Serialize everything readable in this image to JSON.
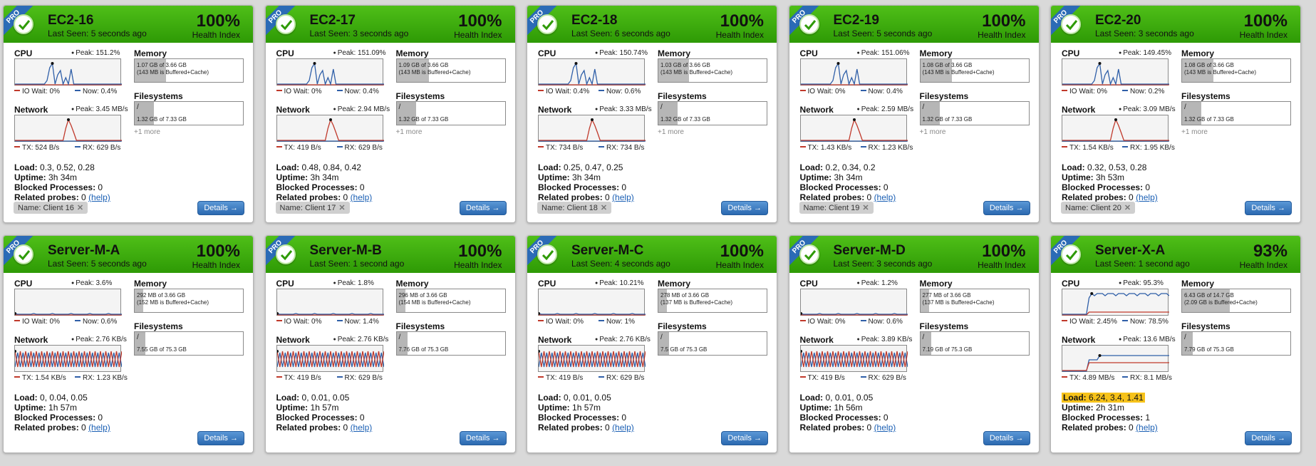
{
  "header": {
    "pro_label": "PRO",
    "health_label": "Health Index"
  },
  "labels": {
    "cpu": "CPU",
    "network": "Network",
    "memory": "Memory",
    "filesystems": "Filesystems",
    "io_wait": "IO Wait:",
    "now": "Now:",
    "peak": "Peak:",
    "tx": "TX:",
    "rx": "RX:",
    "load": "Load:",
    "uptime": "Uptime:",
    "blocked": "Blocked Processes:",
    "related": "Related probes:",
    "help": "(help)",
    "details": "Details →",
    "more": "+1 more"
  },
  "colors": {
    "header_green": "#3aae0e",
    "cpu_line": "#2f5fa8",
    "io_line": "#c0392b",
    "warn": "#f6c21a",
    "button_blue": "#2b69b0"
  },
  "servers": [
    {
      "name": "EC2-16",
      "last_seen": "Last Seen: 5 seconds ago",
      "health": "100%",
      "cpu_peak": "151.2%",
      "io_wait": "0%",
      "now": "0.4%",
      "net_peak": "3.45 MB/s",
      "tx": "524 B/s",
      "rx": "629 B/s",
      "mem_text": "1.07 GB of 3.66 GB",
      "mem_sub": "(143 MB is Buffered+Cache)",
      "mem_frac": 0.29,
      "fs_mount": "/",
      "fs_text": "1.32 GB of 7.33 GB",
      "fs_frac": 0.18,
      "more": "+1 more",
      "load": "0.3, 0.52, 0.28",
      "load_warn": false,
      "uptime": "3h 34m",
      "blocked": "0",
      "related": "0",
      "tag": "Name: Client 16",
      "cpu_profile": "burst",
      "net_profile": "burst"
    },
    {
      "name": "EC2-17",
      "last_seen": "Last Seen: 3 seconds ago",
      "health": "100%",
      "cpu_peak": "151.09%",
      "io_wait": "0%",
      "now": "0.4%",
      "net_peak": "2.94 MB/s",
      "tx": "419 B/s",
      "rx": "629 B/s",
      "mem_text": "1.09 GB of 3.66 GB",
      "mem_sub": "(143 MB is Buffered+Cache)",
      "mem_frac": 0.3,
      "fs_mount": "/",
      "fs_text": "1.32 GB of 7.33 GB",
      "fs_frac": 0.18,
      "more": "+1 more",
      "load": "0.48, 0.84, 0.42",
      "load_warn": false,
      "uptime": "3h 34m",
      "blocked": "0",
      "related": "0",
      "tag": "Name: Client 17",
      "cpu_profile": "burst",
      "net_profile": "burst"
    },
    {
      "name": "EC2-18",
      "last_seen": "Last Seen: 6 seconds ago",
      "health": "100%",
      "cpu_peak": "150.74%",
      "io_wait": "0.4%",
      "now": "0.6%",
      "net_peak": "3.33 MB/s",
      "tx": "734 B/s",
      "rx": "734 B/s",
      "mem_text": "1.03 GB of 3.66 GB",
      "mem_sub": "(143 MB is Buffered+Cache)",
      "mem_frac": 0.28,
      "fs_mount": "/",
      "fs_text": "1.32 GB of 7.33 GB",
      "fs_frac": 0.18,
      "more": "+1 more",
      "load": "0.25, 0.47, 0.25",
      "load_warn": false,
      "uptime": "3h 34m",
      "blocked": "0",
      "related": "0",
      "tag": "Name: Client 18",
      "cpu_profile": "burst",
      "net_profile": "burst"
    },
    {
      "name": "EC2-19",
      "last_seen": "Last Seen: 5 seconds ago",
      "health": "100%",
      "cpu_peak": "151.06%",
      "io_wait": "0%",
      "now": "0.4%",
      "net_peak": "2.59 MB/s",
      "tx": "1.43 KB/s",
      "rx": "1.23 KB/s",
      "mem_text": "1.08 GB of 3.66 GB",
      "mem_sub": "(143 MB is Buffered+Cache)",
      "mem_frac": 0.29,
      "fs_mount": "/",
      "fs_text": "1.32 GB of 7.33 GB",
      "fs_frac": 0.18,
      "more": "+1 more",
      "load": "0.2, 0.34, 0.2",
      "load_warn": false,
      "uptime": "3h 34m",
      "blocked": "0",
      "related": "0",
      "tag": "Name: Client 19",
      "cpu_profile": "burst",
      "net_profile": "burst"
    },
    {
      "name": "EC2-20",
      "last_seen": "Last Seen: 3 seconds ago",
      "health": "100%",
      "cpu_peak": "149.45%",
      "io_wait": "0%",
      "now": "0.2%",
      "net_peak": "3.09 MB/s",
      "tx": "1.54 KB/s",
      "rx": "1.95 KB/s",
      "mem_text": "1.08 GB of 3.66 GB",
      "mem_sub": "(143 MB is Buffered+Cache)",
      "mem_frac": 0.29,
      "fs_mount": "/",
      "fs_text": "1.32 GB of 7.33 GB",
      "fs_frac": 0.18,
      "more": "+1 more",
      "load": "0.32, 0.53, 0.28",
      "load_warn": false,
      "uptime": "3h 53m",
      "blocked": "0",
      "related": "0",
      "tag": "Name: Client 20",
      "cpu_profile": "burst",
      "net_profile": "burst"
    },
    {
      "name": "Server-M-A",
      "last_seen": "Last Seen: 5 seconds ago",
      "health": "100%",
      "cpu_peak": "3.6%",
      "io_wait": "0%",
      "now": "0.6%",
      "net_peak": "2.76 KB/s",
      "tx": "1.54 KB/s",
      "rx": "1.23 KB/s",
      "mem_text": "292 MB of 3.66 GB",
      "mem_sub": "(152 MB is Buffered+Cache)",
      "mem_frac": 0.08,
      "fs_mount": "/",
      "fs_text": "7.55 GB of 75.3 GB",
      "fs_frac": 0.1,
      "more": "",
      "load": "0, 0.04, 0.05",
      "load_warn": false,
      "uptime": "1h 57m",
      "blocked": "0",
      "related": "0",
      "tag": "",
      "cpu_profile": "flat",
      "net_profile": "zigzag"
    },
    {
      "name": "Server-M-B",
      "last_seen": "Last Seen: 1 second ago",
      "health": "100%",
      "cpu_peak": "1.8%",
      "io_wait": "0%",
      "now": "1.4%",
      "net_peak": "2.76 KB/s",
      "tx": "419 B/s",
      "rx": "629 B/s",
      "mem_text": "296 MB of 3.66 GB",
      "mem_sub": "(154 MB is Buffered+Cache)",
      "mem_frac": 0.08,
      "fs_mount": "/",
      "fs_text": "7.76 GB of 75.3 GB",
      "fs_frac": 0.1,
      "more": "",
      "load": "0, 0.01, 0.05",
      "load_warn": false,
      "uptime": "1h 57m",
      "blocked": "0",
      "related": "0",
      "tag": "",
      "cpu_profile": "flat",
      "net_profile": "zigzag"
    },
    {
      "name": "Server-M-C",
      "last_seen": "Last Seen: 4 seconds ago",
      "health": "100%",
      "cpu_peak": "10.21%",
      "io_wait": "0%",
      "now": "1%",
      "net_peak": "2.76 KB/s",
      "tx": "419 B/s",
      "rx": "629 B/s",
      "mem_text": "278 MB of 3.66 GB",
      "mem_sub": "(137 MB is Buffered+Cache)",
      "mem_frac": 0.08,
      "fs_mount": "/",
      "fs_text": "7.5 GB of 75.3 GB",
      "fs_frac": 0.1,
      "more": "",
      "load": "0, 0.01, 0.05",
      "load_warn": false,
      "uptime": "1h 57m",
      "blocked": "0",
      "related": "0",
      "tag": "",
      "cpu_profile": "flat",
      "net_profile": "zigzag"
    },
    {
      "name": "Server-M-D",
      "last_seen": "Last Seen: 3 seconds ago",
      "health": "100%",
      "cpu_peak": "1.2%",
      "io_wait": "0%",
      "now": "0.6%",
      "net_peak": "3.89 KB/s",
      "tx": "419 B/s",
      "rx": "629 B/s",
      "mem_text": "277 MB of 3.66 GB",
      "mem_sub": "(137 MB is Buffered+Cache)",
      "mem_frac": 0.08,
      "fs_mount": "/",
      "fs_text": "7.19 GB of 75.3 GB",
      "fs_frac": 0.1,
      "more": "",
      "load": "0, 0.01, 0.05",
      "load_warn": false,
      "uptime": "1h 56m",
      "blocked": "0",
      "related": "0",
      "tag": "",
      "cpu_profile": "flat",
      "net_profile": "zigzag"
    },
    {
      "name": "Server-X-A",
      "last_seen": "Last Seen: 1 second ago",
      "health": "93%",
      "cpu_peak": "95.3%",
      "io_wait": "2.45%",
      "now": "78.5%",
      "net_peak": "13.6 MB/s",
      "tx": "4.89 MB/s",
      "rx": "8.1 MB/s",
      "mem_text": "6.43 GB of 14.7 GB",
      "mem_sub": "(2.09 GB is Buffered+Cache)",
      "mem_frac": 0.44,
      "fs_mount": "/",
      "fs_text": "7.79 GB of 75.3 GB",
      "fs_frac": 0.1,
      "more": "",
      "load": "6.24, 3.4, 1.41",
      "load_warn": true,
      "uptime": "2h 31m",
      "blocked": "1",
      "related": "0",
      "tag": "",
      "cpu_profile": "high",
      "net_profile": "rise"
    }
  ]
}
